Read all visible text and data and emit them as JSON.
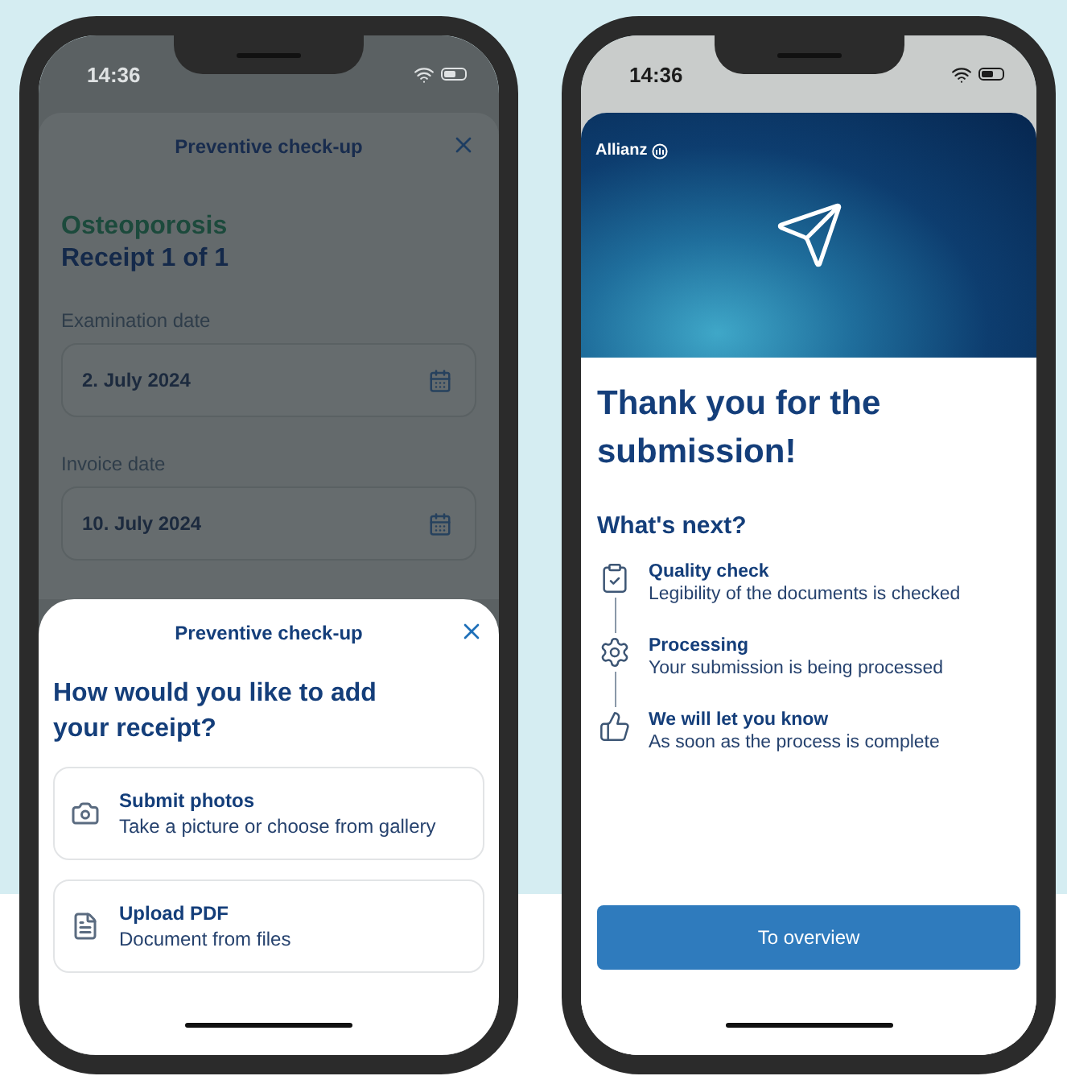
{
  "left_phone": {
    "status_bar": {
      "time": "14:36"
    },
    "background_sheet": {
      "title": "Preventive check-up",
      "category": "Osteoporosis",
      "receipt": "Receipt 1 of 1",
      "fields": [
        {
          "label": "Examination date",
          "value": "2. July 2024"
        },
        {
          "label": "Invoice date",
          "value": "10. July 2024"
        }
      ]
    },
    "bottom_sheet": {
      "title": "Preventive check-up",
      "question": "How would you like to add your receipt?",
      "options": [
        {
          "kind": "camera",
          "title": "Submit photos",
          "subtitle": "Take a picture or choose from gallery"
        },
        {
          "kind": "document",
          "title": "Upload PDF",
          "subtitle": "Document from files"
        }
      ]
    }
  },
  "right_phone": {
    "status_bar": {
      "time": "14:36"
    },
    "hero": {
      "brand": "Allianz"
    },
    "title": "Thank you for the submission!",
    "subtitle": "What's next?",
    "steps": [
      {
        "kind": "clipboard",
        "title": "Quality check",
        "text": "Legibility of the documents is checked"
      },
      {
        "kind": "gears",
        "title": "Processing",
        "text": "Your submission is being processed"
      },
      {
        "kind": "thumb",
        "title": "We will let you know",
        "text": "As soon as the process is complete"
      }
    ],
    "button": "To overview"
  }
}
